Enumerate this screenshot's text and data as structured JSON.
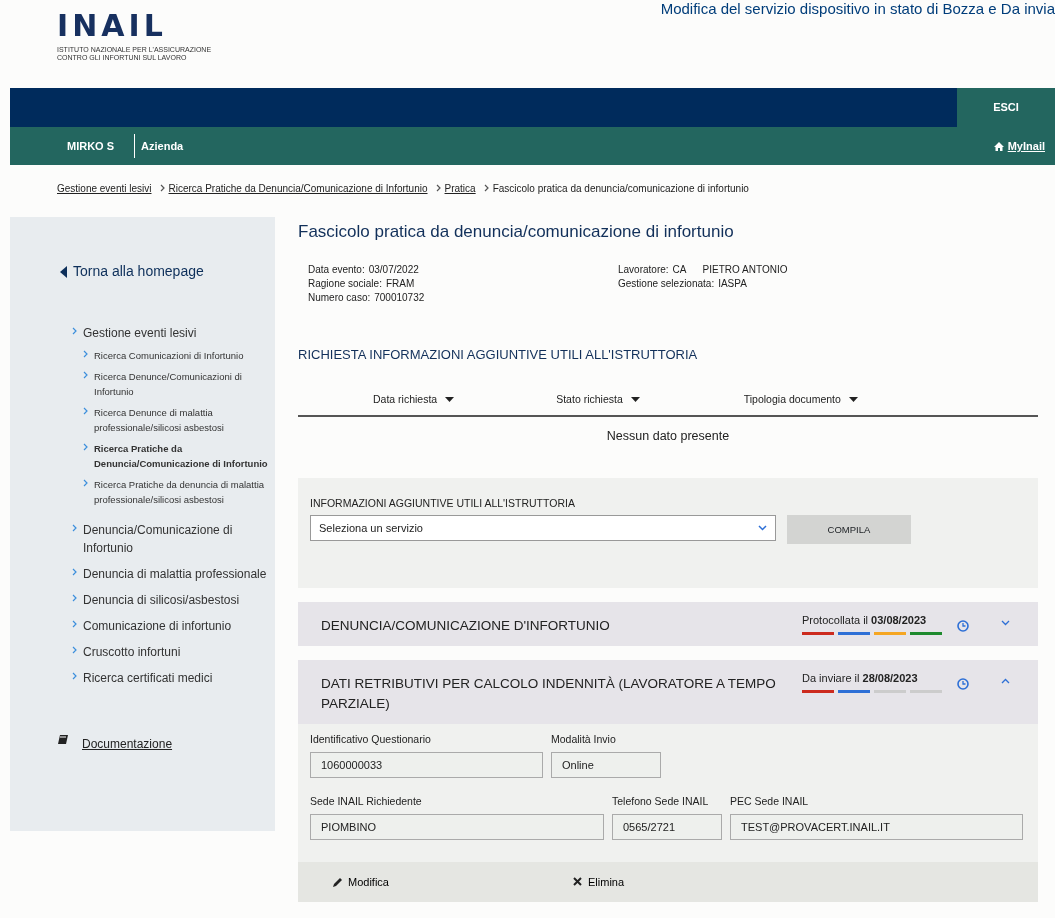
{
  "banner_text": "Modifica del servizio dispositivo in stato di Bozza e Da invia",
  "logo": {
    "name": "INAIL",
    "subtitle": "ISTITUTO NAZIONALE PER L'ASSICURAZIONE CONTRO GLI INFORTUNI SUL LAVORO"
  },
  "top_bar": {
    "logout": "ESCI"
  },
  "user_bar": {
    "user": "MIRKO S",
    "role": "Azienda",
    "link": "MyInail"
  },
  "breadcrumb": [
    {
      "label": "Gestione eventi lesivi",
      "link": true
    },
    {
      "label": "Ricerca Pratiche da Denuncia/Comunicazione di Infortunio",
      "link": true
    },
    {
      "label": "Pratica",
      "link": true
    },
    {
      "label": "Fascicolo pratica da denuncia/comunicazione di infortunio",
      "link": false
    }
  ],
  "sidebar": {
    "back": "Torna alla homepage",
    "items": [
      {
        "label": "Gestione eventi lesivi",
        "selected": false,
        "children": [
          {
            "label": "Ricerca Comunicazioni di Infortunio",
            "selected": false
          },
          {
            "label": "Ricerca Denunce/Comunicazioni di Infortunio",
            "selected": false
          },
          {
            "label": "Ricerca Denunce di malattia professionale/silicosi asbestosi",
            "selected": false
          },
          {
            "label": "Ricerca Pratiche da Denuncia/Comunicazione di Infortunio",
            "selected": true
          },
          {
            "label": "Ricerca Pratiche da denuncia di malattia professionale/silicosi asbestosi",
            "selected": false
          }
        ]
      },
      {
        "label": "Denuncia/Comunicazione di Infortunio",
        "selected": false
      },
      {
        "label": "Denuncia di malattia professionale",
        "selected": false
      },
      {
        "label": "Denuncia di silicosi/asbestosi",
        "selected": false
      },
      {
        "label": "Comunicazione di infortunio",
        "selected": false
      },
      {
        "label": "Cruscotto infortuni",
        "selected": false
      },
      {
        "label": "Ricerca certificati medici",
        "selected": false
      }
    ],
    "documentation": "Documentazione"
  },
  "page_title": "Fascicolo pratica da denuncia/comunicazione di infortunio",
  "summary": {
    "left": [
      {
        "label": "Data evento:",
        "value": "03/07/2022"
      },
      {
        "label": "Ragione sociale:",
        "value": "FRAM"
      },
      {
        "label": "Numero caso:",
        "value": "700010732"
      }
    ],
    "right": [
      {
        "label": "Lavoratore:",
        "value": "CA      PIETRO ANTONIO"
      },
      {
        "label": "Gestione selezionata:",
        "value": "IASPA"
      }
    ]
  },
  "requests": {
    "title": "RICHIESTA INFORMAZIONI AGGIUNTIVE UTILI ALL'ISTRUTTORIA",
    "columns": [
      "Data richiesta",
      "Stato richiesta",
      "Tipologia documento"
    ],
    "empty": "Nessun dato presente"
  },
  "service_form": {
    "label": "INFORMAZIONI AGGIUNTIVE UTILI ALL'ISTRUTTORIA",
    "select_value": "Seleziona un servizio",
    "button": "COMPILA"
  },
  "accordions": [
    {
      "title": "DENUNCIA/COMUNICAZIONE D'INFORTUNIO",
      "status": "Protocollata il",
      "date": "03/08/2023",
      "expanded": false,
      "steps": [
        {
          "color": "#cc2a1e"
        },
        {
          "color": "#2d6fd6"
        },
        {
          "color": "#f5a623"
        },
        {
          "color": "#1e8a2e"
        }
      ]
    },
    {
      "title": "DATI RETRIBUTIVI PER CALCOLO INDENNITÀ (LAVORATORE A TEMPO PARZIALE)",
      "status": "Da inviare il",
      "date": "28/08/2023",
      "expanded": true,
      "steps": [
        {
          "color": "#cc2a1e"
        },
        {
          "color": "#2d6fd6"
        },
        {
          "color": "#cccccc"
        },
        {
          "color": "#cccccc"
        }
      ],
      "fields": [
        [
          {
            "label": "Identificativo Questionario",
            "value": "1060000033"
          },
          {
            "label": "Modalità Invio",
            "value": "Online"
          }
        ],
        [
          {
            "label": "Sede INAIL Richiedente",
            "value": "PIOMBINO"
          },
          {
            "label": "Telefono Sede INAIL",
            "value": "0565/2721"
          },
          {
            "label": "PEC Sede INAIL",
            "value": "TEST@PROVACERT.INAIL.IT"
          }
        ]
      ],
      "actions": [
        {
          "kind": "edit",
          "label": "Modifica"
        },
        {
          "kind": "delete",
          "label": "Elimina"
        }
      ]
    }
  ]
}
